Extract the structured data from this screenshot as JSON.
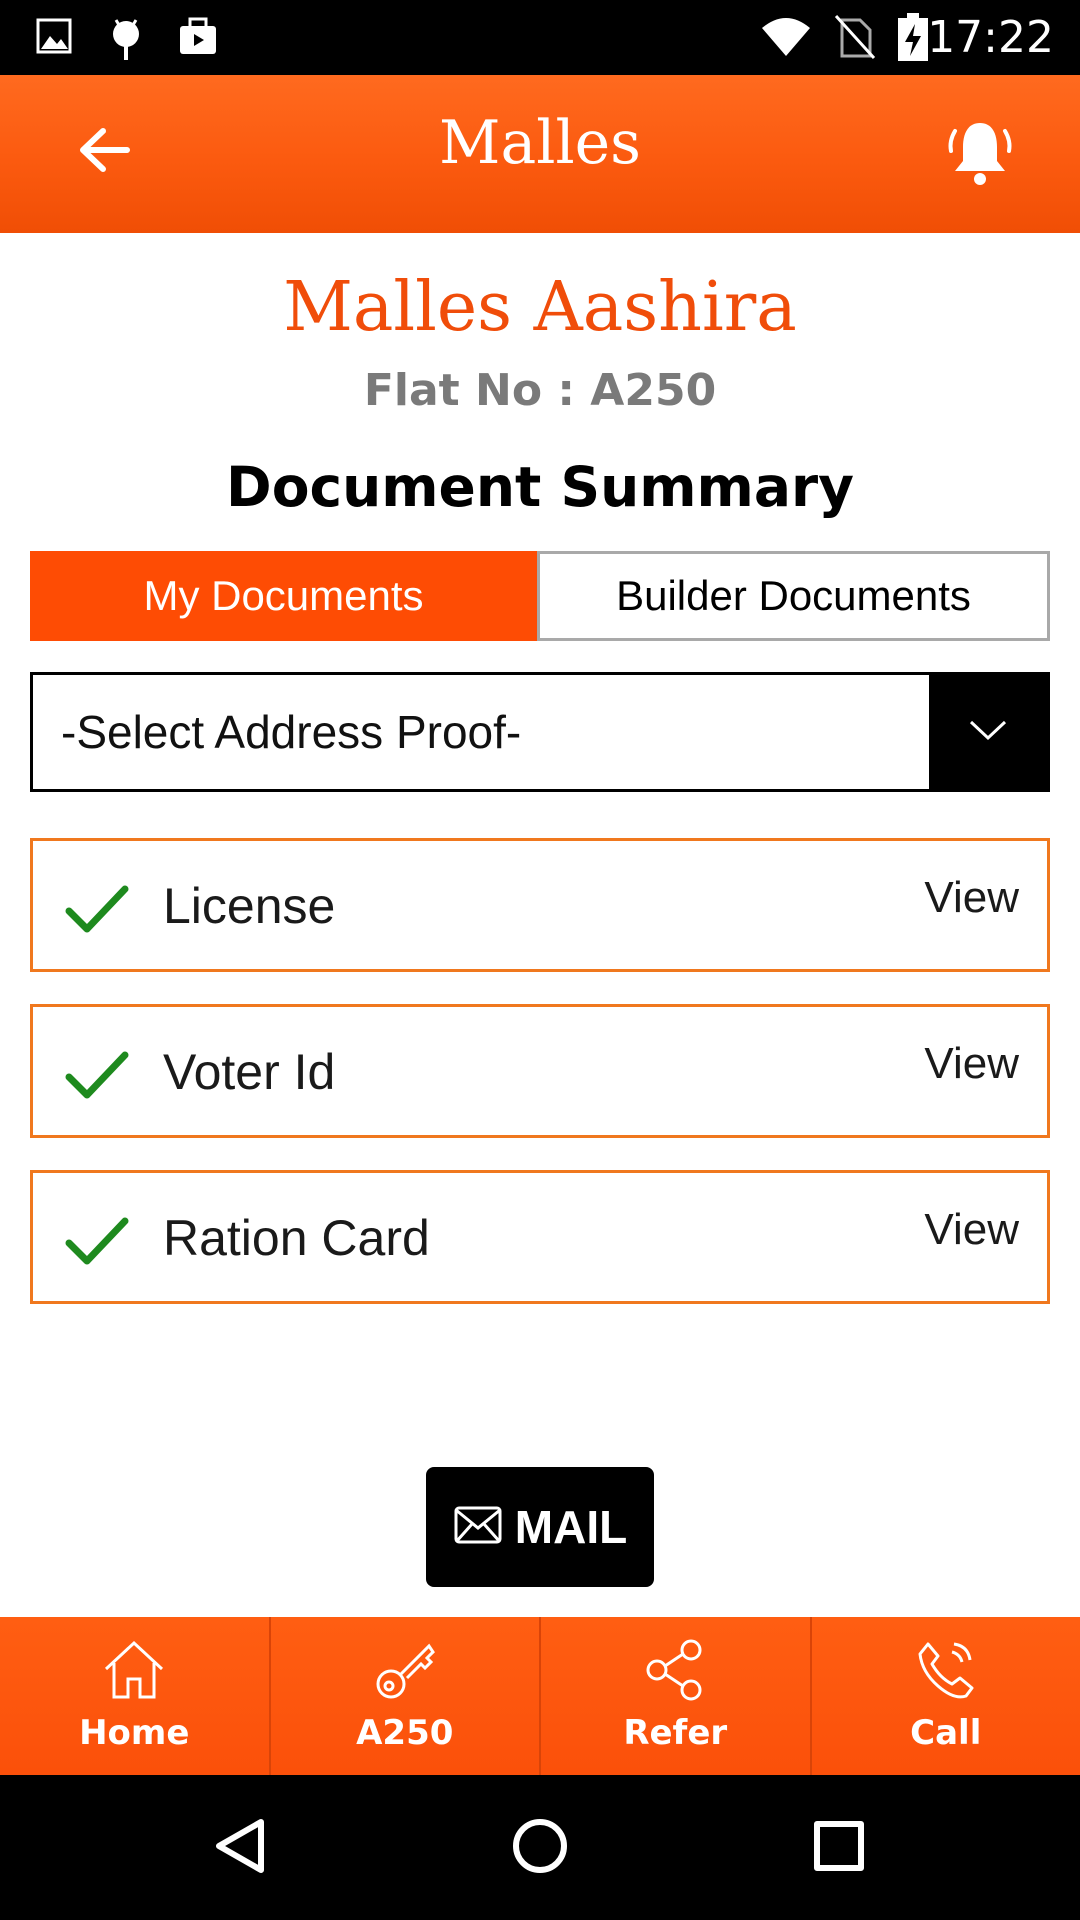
{
  "status_bar": {
    "time": "17:22",
    "left_icons": [
      "image-icon",
      "android-icon",
      "briefcase-icon"
    ],
    "right_icons": [
      "wifi-icon",
      "no-sim-icon",
      "battery-charging-icon"
    ]
  },
  "app_bar": {
    "title": "Malles",
    "back_icon": "arrow-left-icon",
    "bell_icon": "bell-icon"
  },
  "header": {
    "project_name": "Malles Aashira",
    "flat_no": "Flat No : A250",
    "section_title": "Document Summary"
  },
  "tabs": [
    {
      "label": "My Documents",
      "active": true
    },
    {
      "label": "Builder Documents",
      "active": false
    }
  ],
  "select": {
    "value": "-Select Address Proof-"
  },
  "documents": [
    {
      "label": "License",
      "action": "View",
      "checked": true
    },
    {
      "label": "Voter Id",
      "action": "View",
      "checked": true
    },
    {
      "label": "Ration Card",
      "action": "View",
      "checked": true
    }
  ],
  "mail_button": {
    "label": "MAIL",
    "icon": "envelope-icon"
  },
  "bottom_nav": [
    {
      "label": "Home",
      "icon": "home-icon"
    },
    {
      "label": "A250",
      "icon": "key-icon"
    },
    {
      "label": "Refer",
      "icon": "share-icon"
    },
    {
      "label": "Call",
      "icon": "phone-icon"
    }
  ],
  "colors": {
    "primary": "#fe4c04",
    "accent_text": "#f04d0a",
    "item_border": "#f0781e",
    "check": "#1e8a1e"
  }
}
